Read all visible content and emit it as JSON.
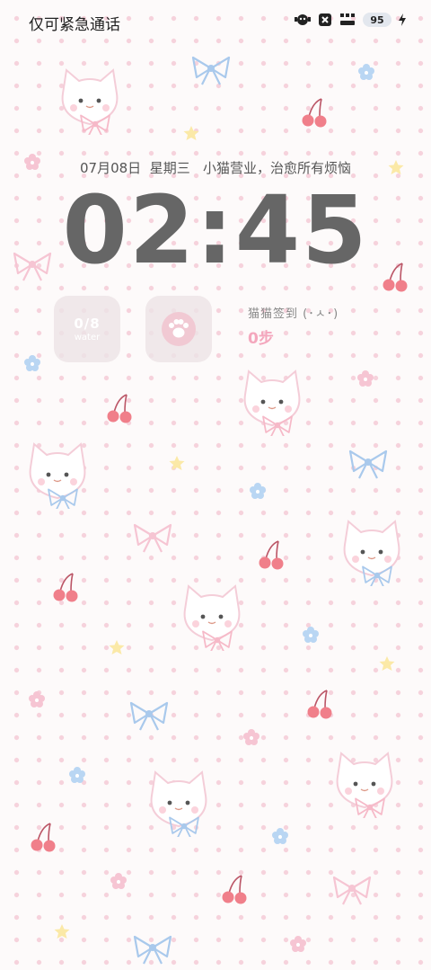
{
  "status_bar": {
    "carrier": "仅可紧急通话",
    "battery_level": "95",
    "icons": [
      "app-notification-icon",
      "close-box-icon",
      "cute-app-icon",
      "battery-icon",
      "charging-icon"
    ]
  },
  "lockscreen": {
    "date_line": "07月08日  星期三   小猫营业，治愈所有烦恼",
    "time": "02:45"
  },
  "widgets": {
    "water": {
      "value": "0/8",
      "label": "water"
    },
    "paw_icon": "paw-icon",
    "sign_in": {
      "title": "猫猫签到 (･ㅅ･)",
      "steps": "0步"
    }
  },
  "colors": {
    "accent_pink": "#f4a7bd",
    "clock_gray": "#666666",
    "dot_pink": "#f6d2dc"
  },
  "wallpaper": {
    "motifs": [
      "cat",
      "bow",
      "cherry",
      "flower",
      "star"
    ]
  }
}
